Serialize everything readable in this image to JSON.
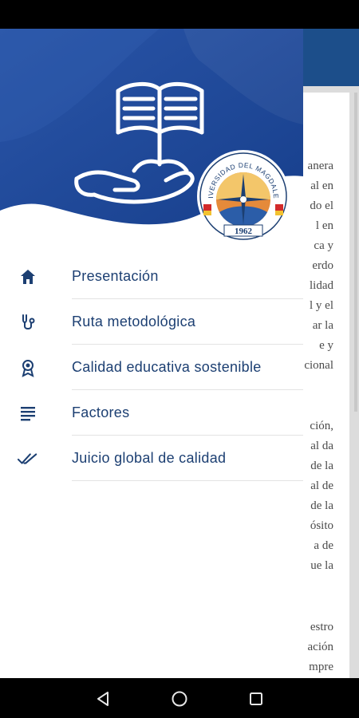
{
  "background_text": [
    "anera",
    "al en",
    "do el",
    "l en",
    "ca y",
    "erdo",
    "lidad",
    "l y el",
    "ar la",
    "e y",
    "cional",
    "ción,",
    "al da",
    "de la",
    "al de",
    "de la",
    "ósito",
    "a de",
    "ue la",
    "estro",
    "ación",
    "mpre"
  ],
  "seal": {
    "name_text": "UNIVERSIDAD DEL MAGDALENA",
    "year": "1962"
  },
  "menu": {
    "items": [
      {
        "label": "Presentación",
        "icon": "home-icon"
      },
      {
        "label": "Ruta metodológica",
        "icon": "stethoscope-icon"
      },
      {
        "label": "Calidad educativa sostenible",
        "icon": "award-icon"
      },
      {
        "label": "Factores",
        "icon": "text-lines-icon"
      },
      {
        "label": "Juicio global de calidad",
        "icon": "double-check-icon"
      }
    ]
  },
  "colors": {
    "header_blue": "#1b4697",
    "menu_text": "#1c3f72",
    "icon_blue": "#1c3f72"
  }
}
